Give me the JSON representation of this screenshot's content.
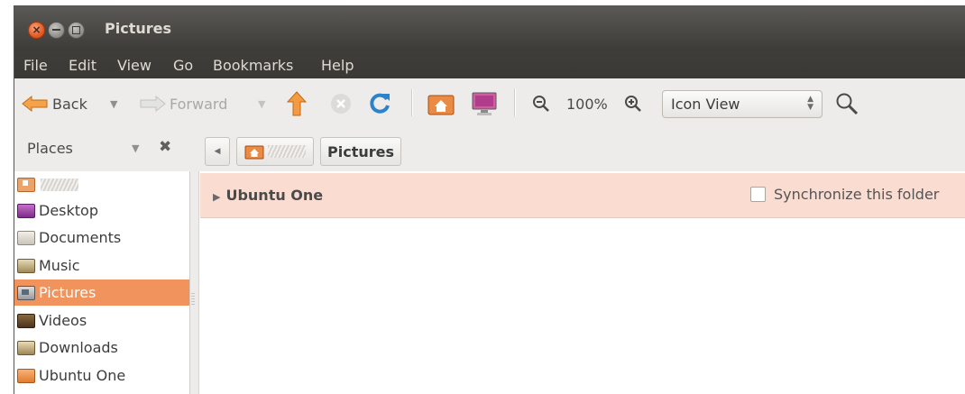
{
  "window": {
    "title": "Pictures"
  },
  "menubar": [
    "File",
    "Edit",
    "View",
    "Go",
    "Bookmarks",
    "Help"
  ],
  "toolbar": {
    "back_label": "Back",
    "forward_label": "Forward",
    "zoom_level": "100%",
    "view_mode": "Icon View"
  },
  "places": {
    "header_label": "Places",
    "items": [
      {
        "label": "",
        "icon": "home-folder-icon"
      },
      {
        "label": "Desktop",
        "icon": "desktop-folder-icon"
      },
      {
        "label": "Documents",
        "icon": "documents-folder-icon"
      },
      {
        "label": "Music",
        "icon": "music-folder-icon"
      },
      {
        "label": "Pictures",
        "icon": "pictures-folder-icon",
        "selected": true
      },
      {
        "label": "Videos",
        "icon": "videos-folder-icon"
      },
      {
        "label": "Downloads",
        "icon": "downloads-folder-icon"
      },
      {
        "label": "Ubuntu One",
        "icon": "ubuntu-one-folder-icon"
      }
    ]
  },
  "breadcrumb": {
    "current": "Pictures"
  },
  "ubuntu_one": {
    "title": "Ubuntu One",
    "sync_label": "Synchronize this folder",
    "sync_checked": false
  },
  "colors": {
    "title_bar": "#3c3b37",
    "selection": "#f0935d",
    "ubuntu_one_bar": "#fadcd0"
  }
}
